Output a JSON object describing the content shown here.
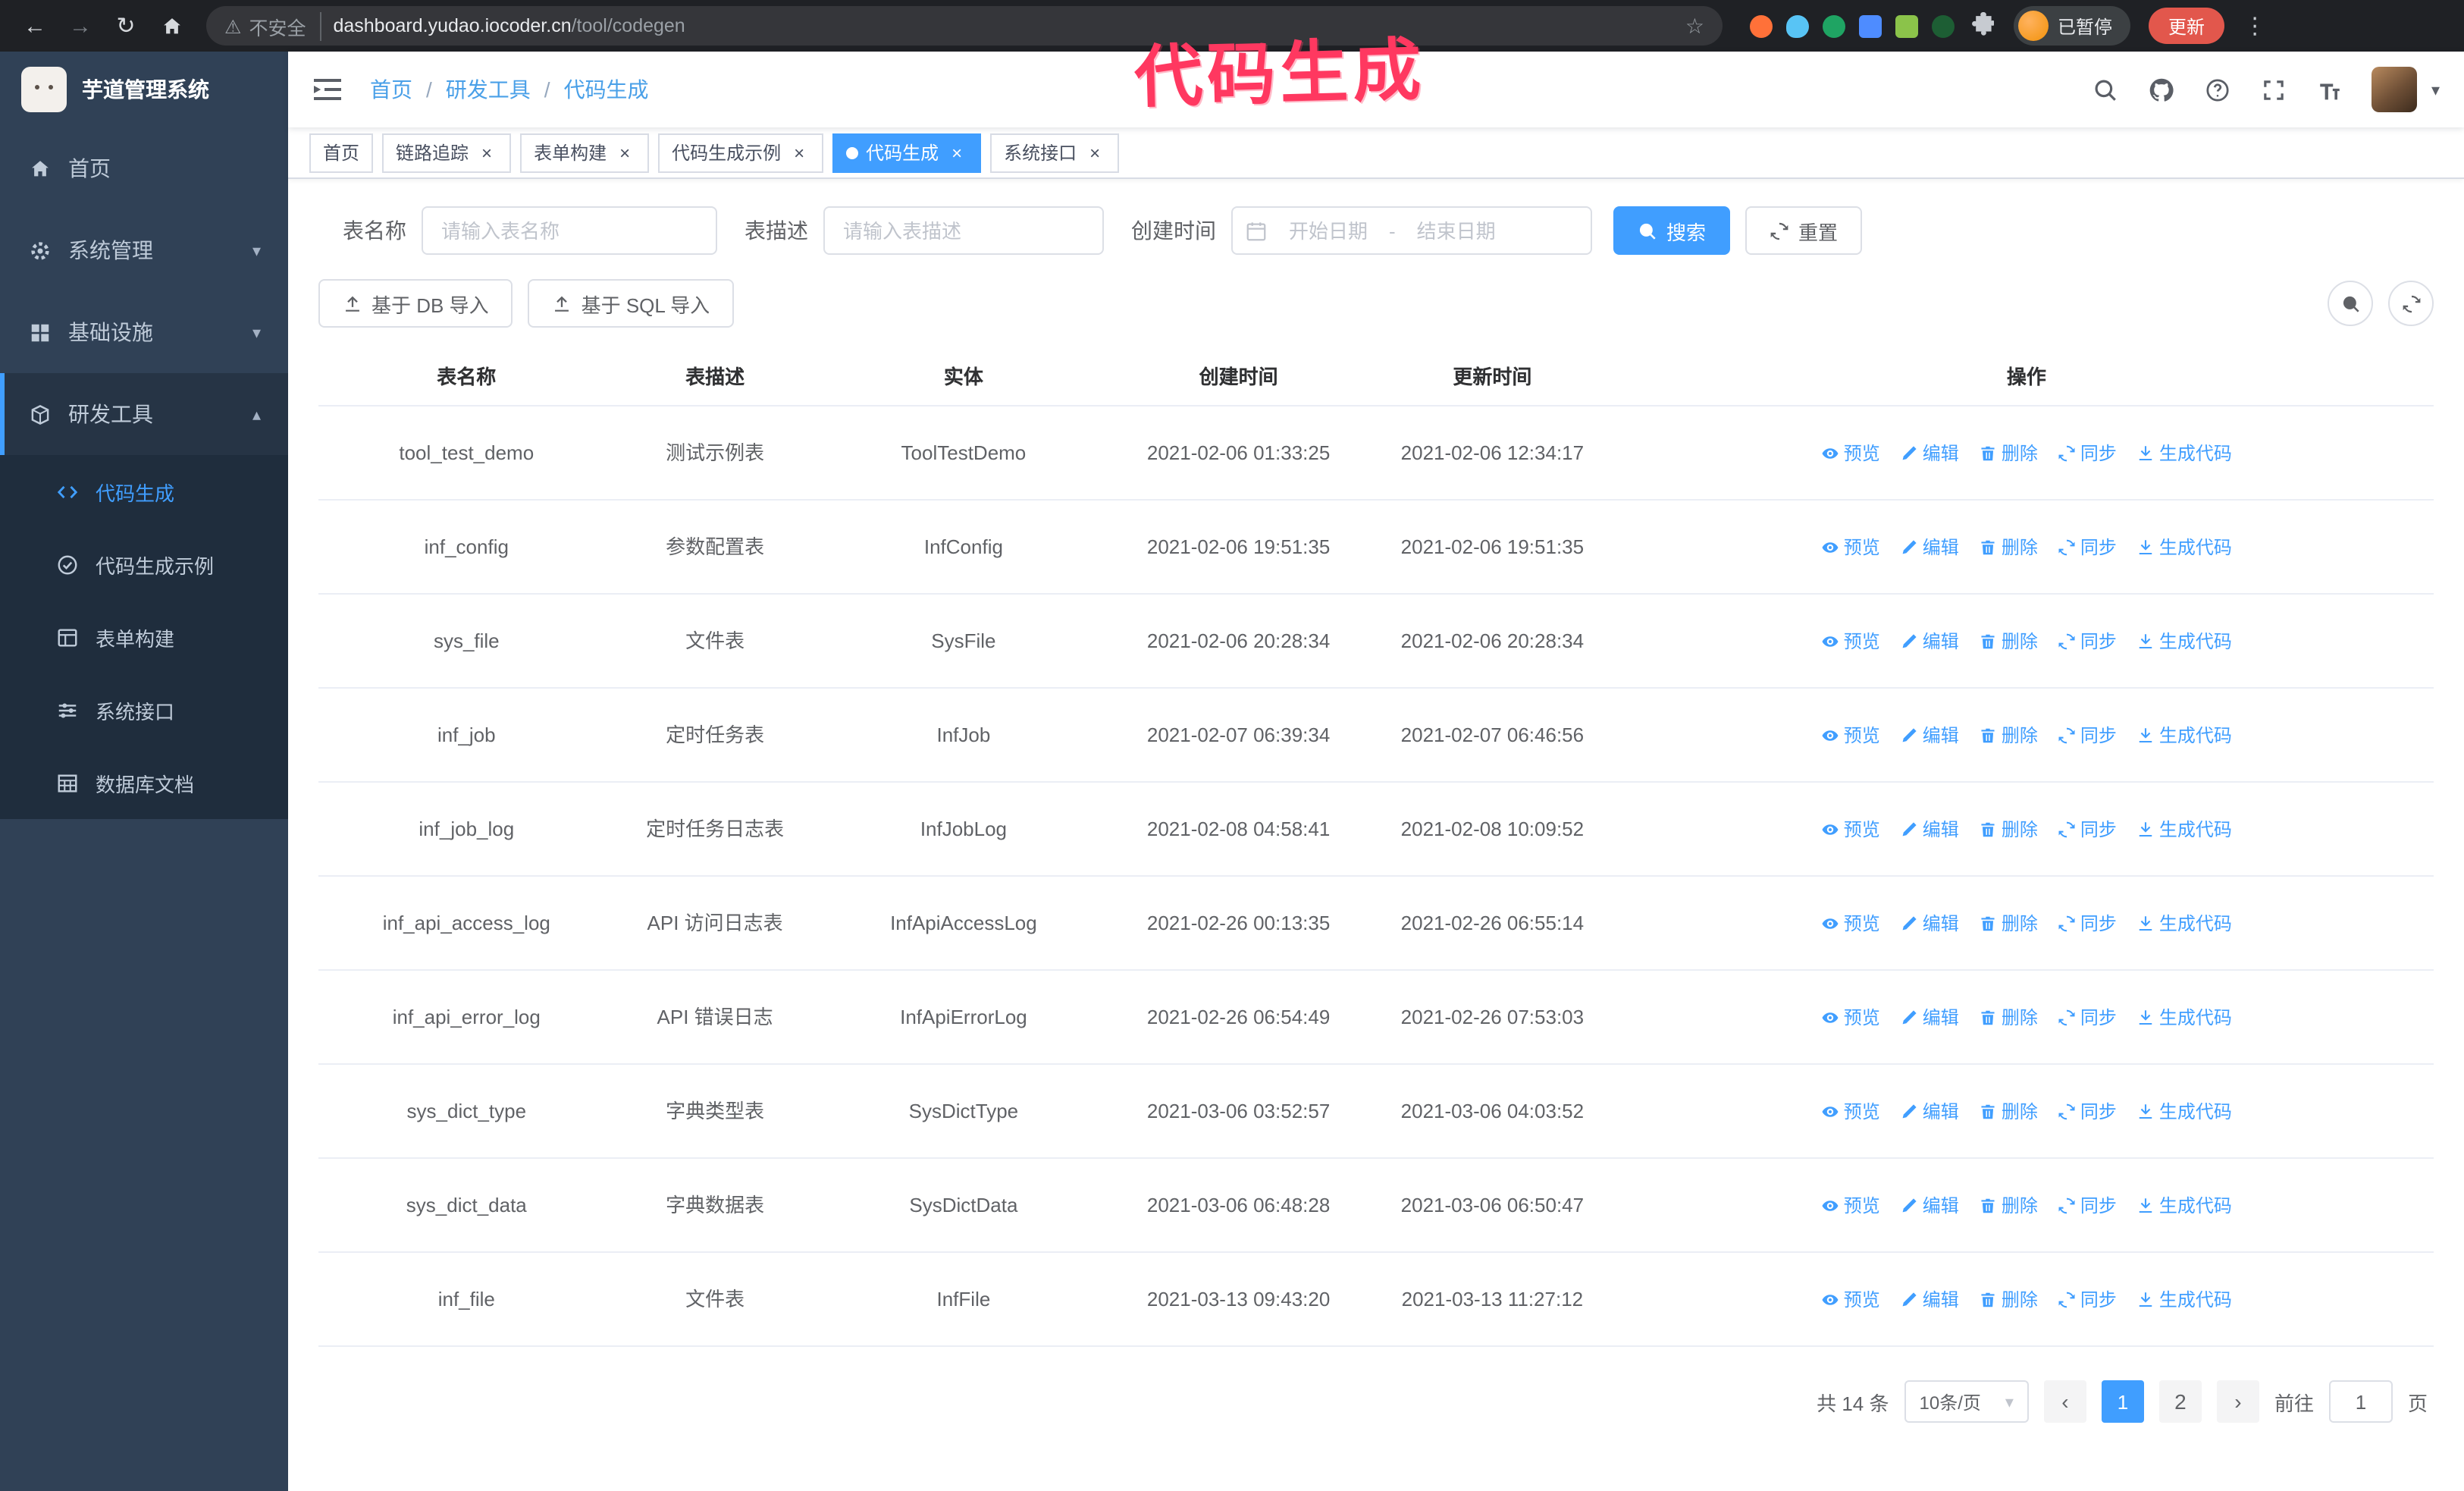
{
  "colors": {
    "accent": "#409eff",
    "annotation": "#ff3860",
    "update_button": "#e2574c",
    "sidebar_bg": "#304156",
    "submenu_bg": "#1f2d3d"
  },
  "ui": {
    "close_icon": "×",
    "caret_icon": "▾"
  },
  "annotation": {
    "text": "代码生成"
  },
  "browser": {
    "back_icon": "←",
    "forward_icon": "→",
    "reload_icon": "↻",
    "warning_icon": "⚠",
    "security_label": "不安全",
    "url_host": "dashboard.yudao.iocoder.cn",
    "url_path": "/tool/codegen",
    "star_icon": "☆",
    "profile_status": "已暂停",
    "update_label": "更新",
    "menu_icon": "⋮"
  },
  "sidebar": {
    "logo_title": "芋道管理系统",
    "items": [
      {
        "label": "首页",
        "chevron": ""
      },
      {
        "label": "系统管理",
        "chevron": "▾"
      },
      {
        "label": "基础设施",
        "chevron": "▾"
      },
      {
        "label": "研发工具",
        "chevron": "▴"
      }
    ],
    "submenu": [
      {
        "label": "代码生成",
        "active": true
      },
      {
        "label": "代码生成示例",
        "active": false
      },
      {
        "label": "表单构建",
        "active": false
      },
      {
        "label": "系统接口",
        "active": false
      },
      {
        "label": "数据库文档",
        "active": false
      }
    ]
  },
  "breadcrumb": {
    "items": [
      "首页",
      "研发工具",
      "代码生成"
    ],
    "separator": "/"
  },
  "tabs": [
    {
      "label": "首页",
      "closable": false,
      "active": false
    },
    {
      "label": "链路追踪",
      "closable": true,
      "active": false
    },
    {
      "label": "表单构建",
      "closable": true,
      "active": false
    },
    {
      "label": "代码生成示例",
      "closable": true,
      "active": false
    },
    {
      "label": "代码生成",
      "closable": true,
      "active": true
    },
    {
      "label": "系统接口",
      "closable": true,
      "active": false
    }
  ],
  "filters": {
    "table_name_label": "表名称",
    "table_name_placeholder": "请输入表名称",
    "table_desc_label": "表描述",
    "table_desc_placeholder": "请输入表描述",
    "create_time_label": "创建时间",
    "date_start_placeholder": "开始日期",
    "date_separator": "-",
    "date_end_placeholder": "结束日期",
    "search_label": "搜索",
    "reset_label": "重置"
  },
  "toolbar": {
    "import_db_label": "基于 DB 导入",
    "import_sql_label": "基于 SQL 导入"
  },
  "table": {
    "columns": [
      "表名称",
      "表描述",
      "实体",
      "创建时间",
      "更新时间",
      "操作"
    ],
    "action_labels": [
      "预览",
      "编辑",
      "删除",
      "同步",
      "生成代码"
    ],
    "rows": [
      {
        "name": "tool_test_demo",
        "desc": "测试示例表",
        "entity": "ToolTestDemo",
        "created": "2021-02-06 01:33:25",
        "updated": "2021-02-06 12:34:17"
      },
      {
        "name": "inf_config",
        "desc": "参数配置表",
        "entity": "InfConfig",
        "created": "2021-02-06 19:51:35",
        "updated": "2021-02-06 19:51:35"
      },
      {
        "name": "sys_file",
        "desc": "文件表",
        "entity": "SysFile",
        "created": "2021-02-06 20:28:34",
        "updated": "2021-02-06 20:28:34"
      },
      {
        "name": "inf_job",
        "desc": "定时任务表",
        "entity": "InfJob",
        "created": "2021-02-07 06:39:34",
        "updated": "2021-02-07 06:46:56"
      },
      {
        "name": "inf_job_log",
        "desc": "定时任务日志表",
        "entity": "InfJobLog",
        "created": "2021-02-08 04:58:41",
        "updated": "2021-02-08 10:09:52"
      },
      {
        "name": "inf_api_access_log",
        "desc": "API 访问日志表",
        "entity": "InfApiAccessLog",
        "created": "2021-02-26 00:13:35",
        "updated": "2021-02-26 06:55:14"
      },
      {
        "name": "inf_api_error_log",
        "desc": "API 错误日志",
        "entity": "InfApiErrorLog",
        "created": "2021-02-26 06:54:49",
        "updated": "2021-02-26 07:53:03"
      },
      {
        "name": "sys_dict_type",
        "desc": "字典类型表",
        "entity": "SysDictType",
        "created": "2021-03-06 03:52:57",
        "updated": "2021-03-06 04:03:52"
      },
      {
        "name": "sys_dict_data",
        "desc": "字典数据表",
        "entity": "SysDictData",
        "created": "2021-03-06 06:48:28",
        "updated": "2021-03-06 06:50:47"
      },
      {
        "name": "inf_file",
        "desc": "文件表",
        "entity": "InfFile",
        "created": "2021-03-13 09:43:20",
        "updated": "2021-03-13 11:27:12"
      }
    ]
  },
  "pagination": {
    "total_label": "共 14 条",
    "page_size_label": "10条/页",
    "prev_icon": "‹",
    "next_icon": "›",
    "pages": [
      "1",
      "2"
    ],
    "active_page": "1",
    "goto_label": "前往",
    "goto_value": "1",
    "page_unit": "页"
  }
}
